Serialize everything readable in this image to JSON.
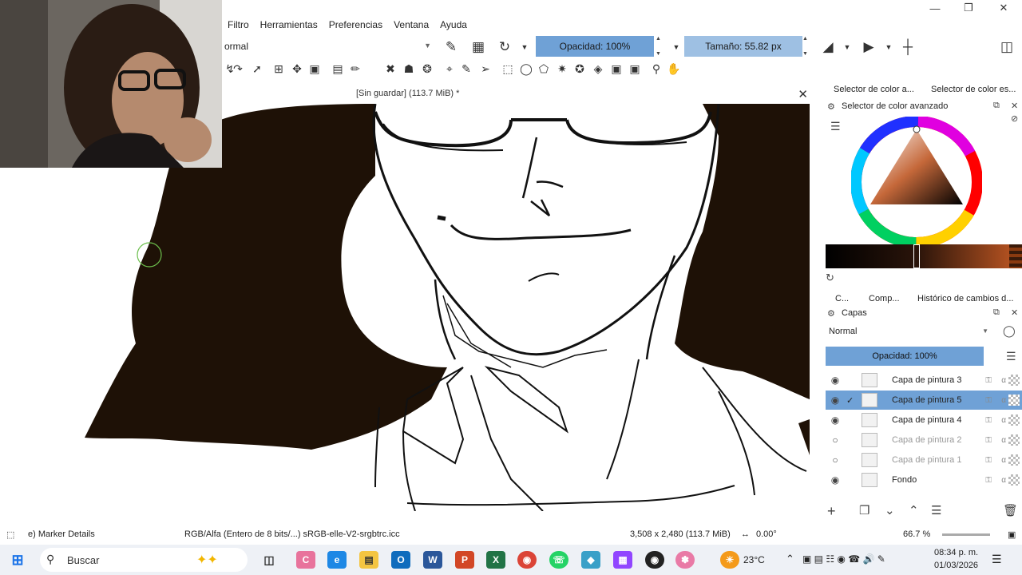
{
  "window": {
    "minimize_icon": "minimize-icon",
    "restore_icon": "restore-icon",
    "close_icon": "close-icon"
  },
  "menu": {
    "items": [
      "Filtro",
      "Herramientas",
      "Preferencias",
      "Ventana",
      "Ayuda"
    ]
  },
  "toolbar": {
    "blend_mode": "ormal",
    "opacity_label": "Opacidad: 100%",
    "size_label": "Tamaño: 55.82 px"
  },
  "document": {
    "title": "[Sin guardar]  (113.7 MiB) *"
  },
  "docker": {
    "tabs": [
      "Selector de color a...",
      "Selector de color es..."
    ],
    "color_selector_title": "Selector de color avanzado",
    "bottom_tabs": [
      "C...",
      "Comp...",
      "Histórico de cambios d..."
    ],
    "layers_title": "Capas",
    "layers_blend": "Normal",
    "layers_opacity": "Opacidad:  100%",
    "layers": [
      {
        "name": "Capa de pintura 3",
        "visible": true,
        "selected": false,
        "dim": false,
        "checked": false
      },
      {
        "name": "Capa de pintura 5",
        "visible": true,
        "selected": true,
        "dim": false,
        "checked": true
      },
      {
        "name": "Capa de pintura 4",
        "visible": true,
        "selected": false,
        "dim": false,
        "checked": false
      },
      {
        "name": "Capa de pintura 2",
        "visible": false,
        "selected": false,
        "dim": true,
        "checked": false
      },
      {
        "name": "Capa de pintura 1",
        "visible": false,
        "selected": false,
        "dim": true,
        "checked": false
      },
      {
        "name": "Fondo",
        "visible": true,
        "selected": false,
        "dim": false,
        "checked": false
      }
    ]
  },
  "status": {
    "brush": "e) Marker Details",
    "color_space": "RGB/Alfa (Entero de 8 bits/...)  sRGB-elle-V2-srgbtrc.icc",
    "dimensions": "3,508 x 2,480 (113.7 MiB)",
    "rotation": "0.00°",
    "zoom": "66.7 %"
  },
  "taskbar": {
    "search_placeholder": "Buscar",
    "weather": "23°C",
    "time": "08:34 p. m.",
    "date": "01/03/2026"
  },
  "colors": {
    "accent": "#6fa1d6",
    "hair": "#1e1106",
    "ink": "#111111"
  }
}
